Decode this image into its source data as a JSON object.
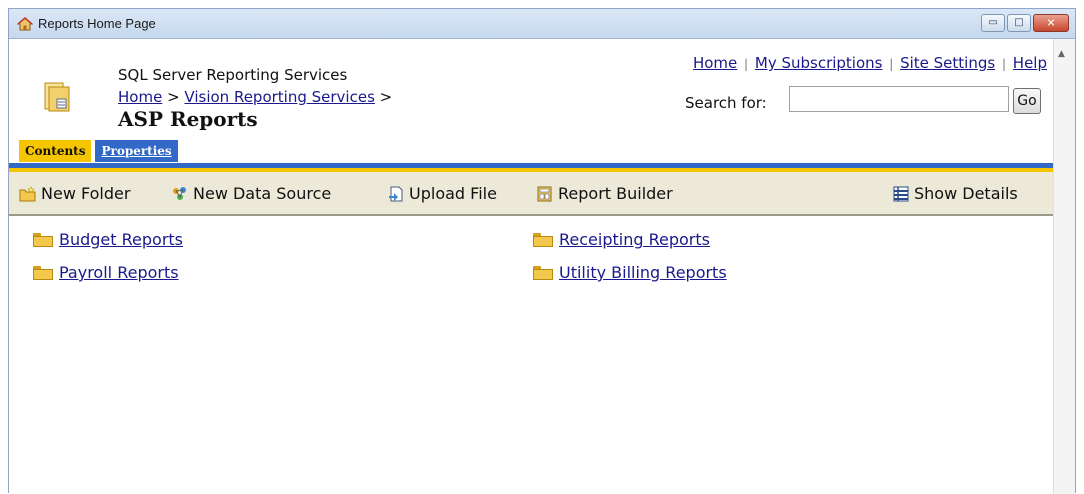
{
  "window": {
    "title": "Reports Home Page",
    "buttons": {
      "minimize": "▭",
      "maximize": "□",
      "close": "✕"
    }
  },
  "header": {
    "app_name": "SQL Server Reporting Services",
    "breadcrumb": {
      "home": "Home",
      "sep1": " > ",
      "vision": "Vision Reporting Services",
      "sep2": " >"
    },
    "page_title": "ASP Reports",
    "top_links": {
      "home": "Home",
      "my_subscriptions": "My Subscriptions",
      "site_settings": "Site Settings",
      "help": "Help",
      "separator": "|"
    },
    "search": {
      "label": "Search for:",
      "value": "",
      "button": "Go"
    }
  },
  "tabs": [
    {
      "label": "Contents",
      "active": true
    },
    {
      "label": "Properties",
      "active": false
    }
  ],
  "toolbar": {
    "new_folder": "New Folder",
    "new_data_source": "New Data Source",
    "upload_file": "Upload File",
    "report_builder": "Report Builder",
    "show_details": "Show Details"
  },
  "folders": {
    "budget": "Budget Reports",
    "payroll": "Payroll Reports",
    "receipting": "Receipting Reports",
    "utility": "Utility Billing Reports"
  },
  "colors": {
    "tab_active": "#f5c500",
    "tab_inactive": "#3269c6",
    "link": "#1a1a8c",
    "toolbar_bg": "#ece9d8"
  },
  "icons": [
    "home-icon",
    "big-folder-icon",
    "new-folder-icon",
    "data-source-icon",
    "upload-file-icon",
    "report-builder-icon",
    "show-details-icon",
    "folder-icon"
  ]
}
